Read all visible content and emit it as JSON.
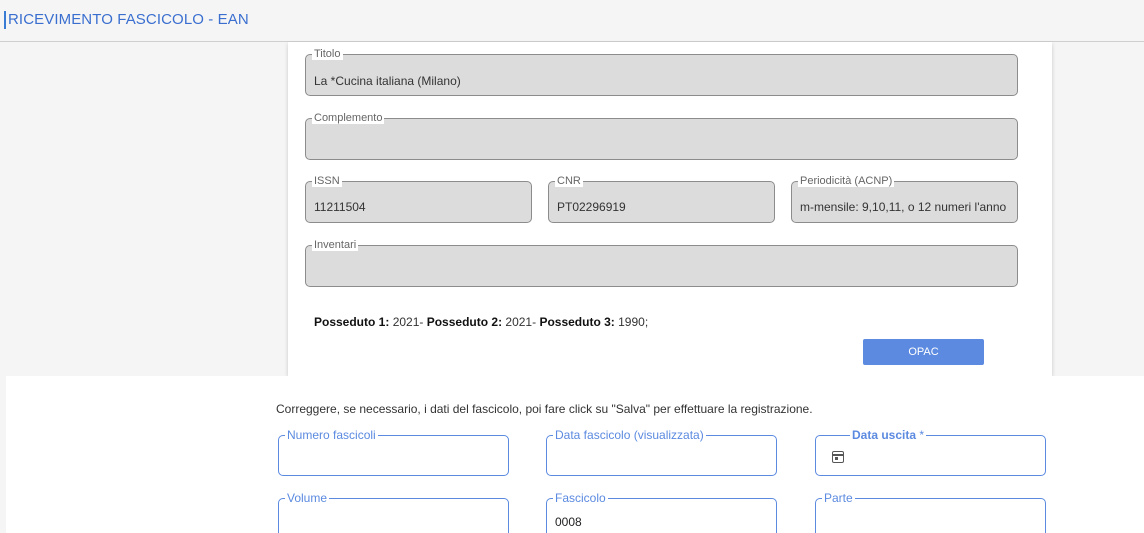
{
  "header": {
    "title": "RICEVIMENTO FASCICOLO - EAN"
  },
  "record": {
    "titolo": {
      "label": "Titolo",
      "value": "La *Cucina italiana (Milano)"
    },
    "complemento": {
      "label": "Complemento",
      "value": ""
    },
    "issn": {
      "label": "ISSN",
      "value": "11211504"
    },
    "cnr": {
      "label": "CNR",
      "value": "PT02296919"
    },
    "periodicita": {
      "label": "Periodicità (ACNP)",
      "value": "m-mensile: 9,10,11, o 12 numeri l'anno"
    },
    "inventari": {
      "label": "Inventari",
      "value": ""
    },
    "posseduto": [
      {
        "label": "Posseduto 1:",
        "value": " 2021- "
      },
      {
        "label": "Posseduto 2:",
        "value": " 2021- "
      },
      {
        "label": "Posseduto 3:",
        "value": " 1990;"
      }
    ],
    "opac_label": "OPAC"
  },
  "form": {
    "instructions": "Correggere, se necessario, i dati del fascicolo, poi fare click su \"Salva\" per effettuare la registrazione.",
    "numero_fascicoli": {
      "label": "Numero fascicoli",
      "value": ""
    },
    "data_fascicolo": {
      "label": "Data fascicolo (visualizzata)",
      "value": ""
    },
    "data_uscita": {
      "label": "Data uscita",
      "required_mark": " *",
      "value": ""
    },
    "volume": {
      "label": "Volume",
      "value": ""
    },
    "fascicolo": {
      "label": "Fascicolo",
      "value": "0008"
    },
    "parte": {
      "label": "Parte",
      "value": ""
    }
  },
  "colors": {
    "accent": "#5b8ae0",
    "title": "#3a6fd0",
    "readonly_bg": "#dcdcdc"
  },
  "icons": {
    "date_picker": "calendar-icon"
  }
}
